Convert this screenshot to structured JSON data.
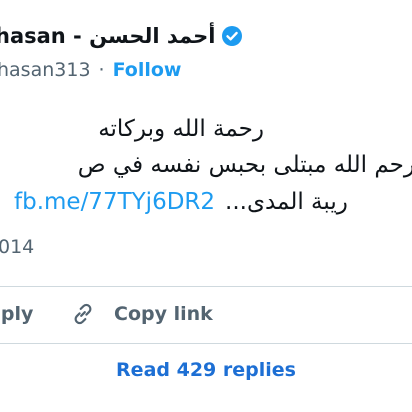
{
  "author": {
    "name": "hasan - أحمد الحسن",
    "handle": "hasan313",
    "separator": "·",
    "follow_label": "Follow"
  },
  "tweet": {
    "lines": [
      "رحمة الله وبركاته",
      "رحم الله مبتلى بحبس نفسه في ص",
      "ريبة المدى..."
    ],
    "link_text": "fb.me/77TYj6DR2",
    "date": "014"
  },
  "actions": {
    "reply_label": "eply",
    "copy_link_label": "Copy link"
  },
  "footer": {
    "read_replies_label": "Read 429 replies"
  },
  "colors": {
    "accent": "#1d9bf0",
    "muted_text": "#536471",
    "divider": "#cfd9de",
    "primary_text": "#0f1419"
  },
  "icons": {
    "verified": "verified-badge-icon",
    "copy_link": "link-icon"
  }
}
